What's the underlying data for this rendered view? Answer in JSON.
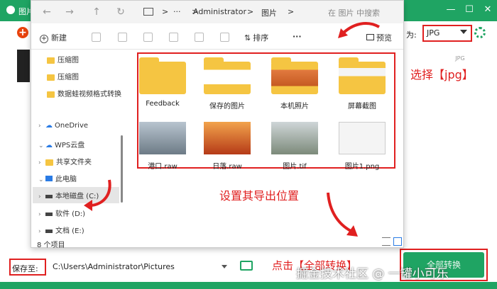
{
  "app": {
    "title": "图片"
  },
  "window_controls": {
    "minimize": "—",
    "maximize": "☐",
    "close": "✕"
  },
  "format": {
    "label": "为:",
    "value": "JPG",
    "card_label": "JPG"
  },
  "dialog": {
    "address": {
      "more": "···",
      "crumb1": "Administrator",
      "crumb2": "图片",
      "sep": ">"
    },
    "search_placeholder": "在 图片 中搜索",
    "toolbar": {
      "new_label": "新建",
      "sort_label": "排序",
      "more_label": "···",
      "preview_label": "预览"
    },
    "tree": [
      {
        "label": "压缩图",
        "type": "folder"
      },
      {
        "label": "压缩图",
        "type": "folder"
      },
      {
        "label": "数据蛙视频格式转换",
        "type": "folder"
      },
      {
        "label": "OneDrive",
        "type": "cloud"
      },
      {
        "label": "WPS云盘",
        "type": "cloud"
      },
      {
        "label": "共享文件夹",
        "type": "folder"
      },
      {
        "label": "此电脑",
        "type": "pc"
      },
      {
        "label": "本地磁盘 (C:)",
        "type": "drive"
      },
      {
        "label": "软件 (D:)",
        "type": "drive"
      },
      {
        "label": "文档 (E:)",
        "type": "drive"
      }
    ],
    "files": [
      {
        "name": "Feedback",
        "kind": "folder"
      },
      {
        "name": "保存的图片",
        "kind": "folder-saved"
      },
      {
        "name": "本机照片",
        "kind": "folder-photo"
      },
      {
        "name": "屏幕截图",
        "kind": "folder-shot"
      },
      {
        "name": "港口.raw",
        "kind": "harbor"
      },
      {
        "name": "日落.raw",
        "kind": "sunset"
      },
      {
        "name": "图片.tif",
        "kind": "tif"
      },
      {
        "name": "图片1.png",
        "kind": "png"
      }
    ],
    "status": "8 个项目"
  },
  "annotations": {
    "select_jpg": "选择【jpg】",
    "set_path": "设置其导出位置",
    "convert_all": "点击【全部转换】"
  },
  "bottom": {
    "save_label": "保存至:",
    "save_path": "C:\\Users\\Administrator\\Pictures",
    "convert_button": "全部转换",
    "watermark": "掘金技术社区 @ 一罐小可乐"
  },
  "colors": {
    "brand_green": "#1fa463",
    "annotation_red": "#e02020"
  }
}
